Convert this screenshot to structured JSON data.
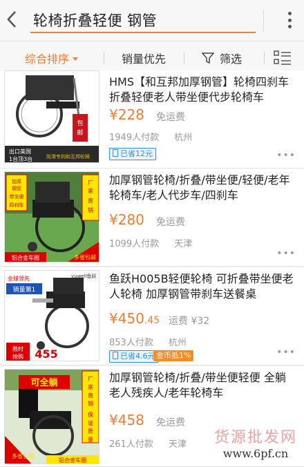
{
  "search": {
    "query": "轮椅折叠轻便 钢管"
  },
  "sort": {
    "comprehensive": "综合排序",
    "sales": "销量优先",
    "filter": "筛选"
  },
  "items": [
    {
      "title": "HMS【和互邦加厚钢管】轮椅四刹车折叠轻便老人带坐便代步轮椅车",
      "price": "¥228",
      "shipping": "免运费",
      "sold": "1949人付款",
      "city": "杭州",
      "badge": "已省12元",
      "thumb_text": [
        "出口美国",
        "1台顶3台",
        "包邮"
      ]
    },
    {
      "title": "加厚钢管轮椅/折叠/带坐便/轻便/老年轮椅车/老人代步车/四刹车",
      "price": "¥280",
      "shipping": "免运费",
      "sold": "1099人付款",
      "city": "天津",
      "thumb_text": [
        "加厚钢管",
        "带坐便",
        "四刹车",
        "厂家直销",
        "铝合金车圈",
        "多省包邮"
      ]
    },
    {
      "title": "鱼跃H005B轻便轮椅 可折叠带坐便老人轮椅 加厚钢管带刹车送餐桌",
      "price_main": "¥450",
      "price_decimal": ".45",
      "shipping": "运费 ¥32",
      "sold": "853人付款",
      "city": "杭州",
      "badge": "已省4.6元",
      "badge2": "金币抵1%",
      "thumb_text": [
        "全球领先",
        "销量第1",
        "yuwell鱼跃",
        "限时抢购",
        "455"
      ]
    },
    {
      "title": "加厚钢管轮椅/折叠/带坐便轻便 全躺老人残疾人/老年轮椅车",
      "price": "¥458",
      "shipping": "免运费",
      "sold": "261人付款",
      "city": "天津",
      "thumb_text": [
        "可全躺",
        "厂家直销",
        "保证质量",
        "多省包邮",
        "铝合金车圈"
      ]
    }
  ],
  "watermark": {
    "line1": "货源批发网",
    "line2": "www.6pf.cn"
  },
  "colors": {
    "accent": "#f27c2f",
    "badge_blue": "#2e8be6"
  }
}
